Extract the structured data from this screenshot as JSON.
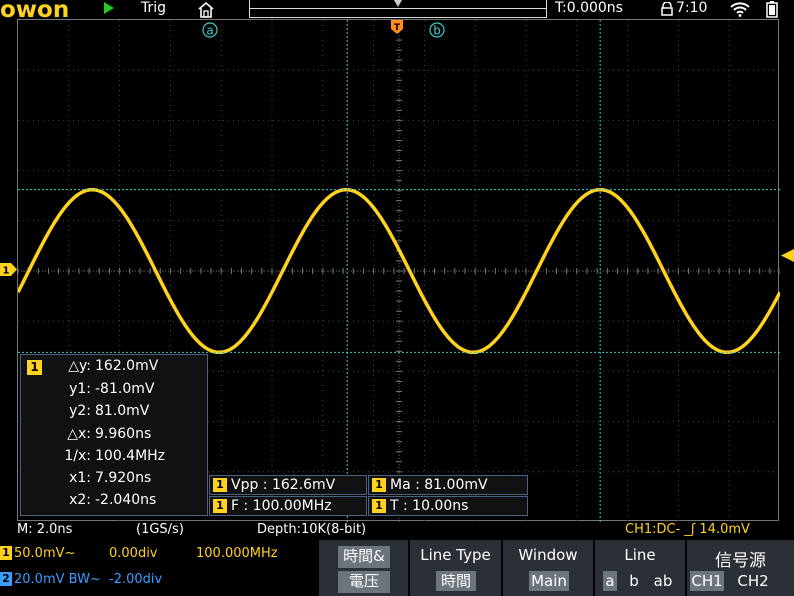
{
  "topbar": {
    "logo": "owon",
    "run_icon": "play-icon",
    "trigger_label": "Trig",
    "trigger_time": "T:0.000ns",
    "clock": "7:10",
    "trigger_marker": "T"
  },
  "cursors": {
    "a_label": "a",
    "b_label": "b"
  },
  "cursor_panel": {
    "channel": "1",
    "dy_key": "△y:",
    "dy": "162.0mV",
    "y1_key": "y1:",
    "y1": "-81.0mV",
    "y2_key": "y2:",
    "y2": "81.0mV",
    "dx_key": "△x:",
    "dx": "9.960ns",
    "inv_key": "1/x:",
    "inv": "100.4MHz",
    "x1_key": "x1:",
    "x1": "7.920ns",
    "x2_key": "x2:",
    "x2": "-2.040ns"
  },
  "measurements": {
    "vpp": {
      "ch": "1",
      "text": "Vpp : 162.6mV"
    },
    "ma": {
      "ch": "1",
      "text": "Ma : 81.00mV"
    },
    "f": {
      "ch": "1",
      "text": "F : 100.00MHz"
    },
    "t": {
      "ch": "1",
      "text": "T : 10.00ns"
    }
  },
  "status": {
    "timebase": "M: 2.0ns",
    "sample_rate": "(1GS/s)",
    "depth": "Depth:10K(8-bit)",
    "trigger": "CH1:DC- _ʃ 14.0mV"
  },
  "channels": {
    "ch1": {
      "badge": "1",
      "scale": "50.0mV~",
      "offset": "0.00div",
      "freq": "100.000MHz"
    },
    "ch2": {
      "badge": "2",
      "scale": "20.0mV BW~",
      "offset": "-2.00div"
    }
  },
  "menu": {
    "mode_top": "時間&",
    "mode_bottom": "電压",
    "line_type_title": "Line Type",
    "line_type_value": "時間",
    "window_title": "Window",
    "window_value": "Main",
    "line_title": "Line",
    "line_a": "a",
    "line_b": "b",
    "line_ab": "ab",
    "source_title": "信号源",
    "source_ch1": "CH1",
    "source_ch2": "CH2"
  },
  "colors": {
    "ch1": "#ffd21e",
    "ch2": "#3b9dff",
    "cursor": "#3fc9c9",
    "trigger_marker": "#ff8a1e"
  }
}
